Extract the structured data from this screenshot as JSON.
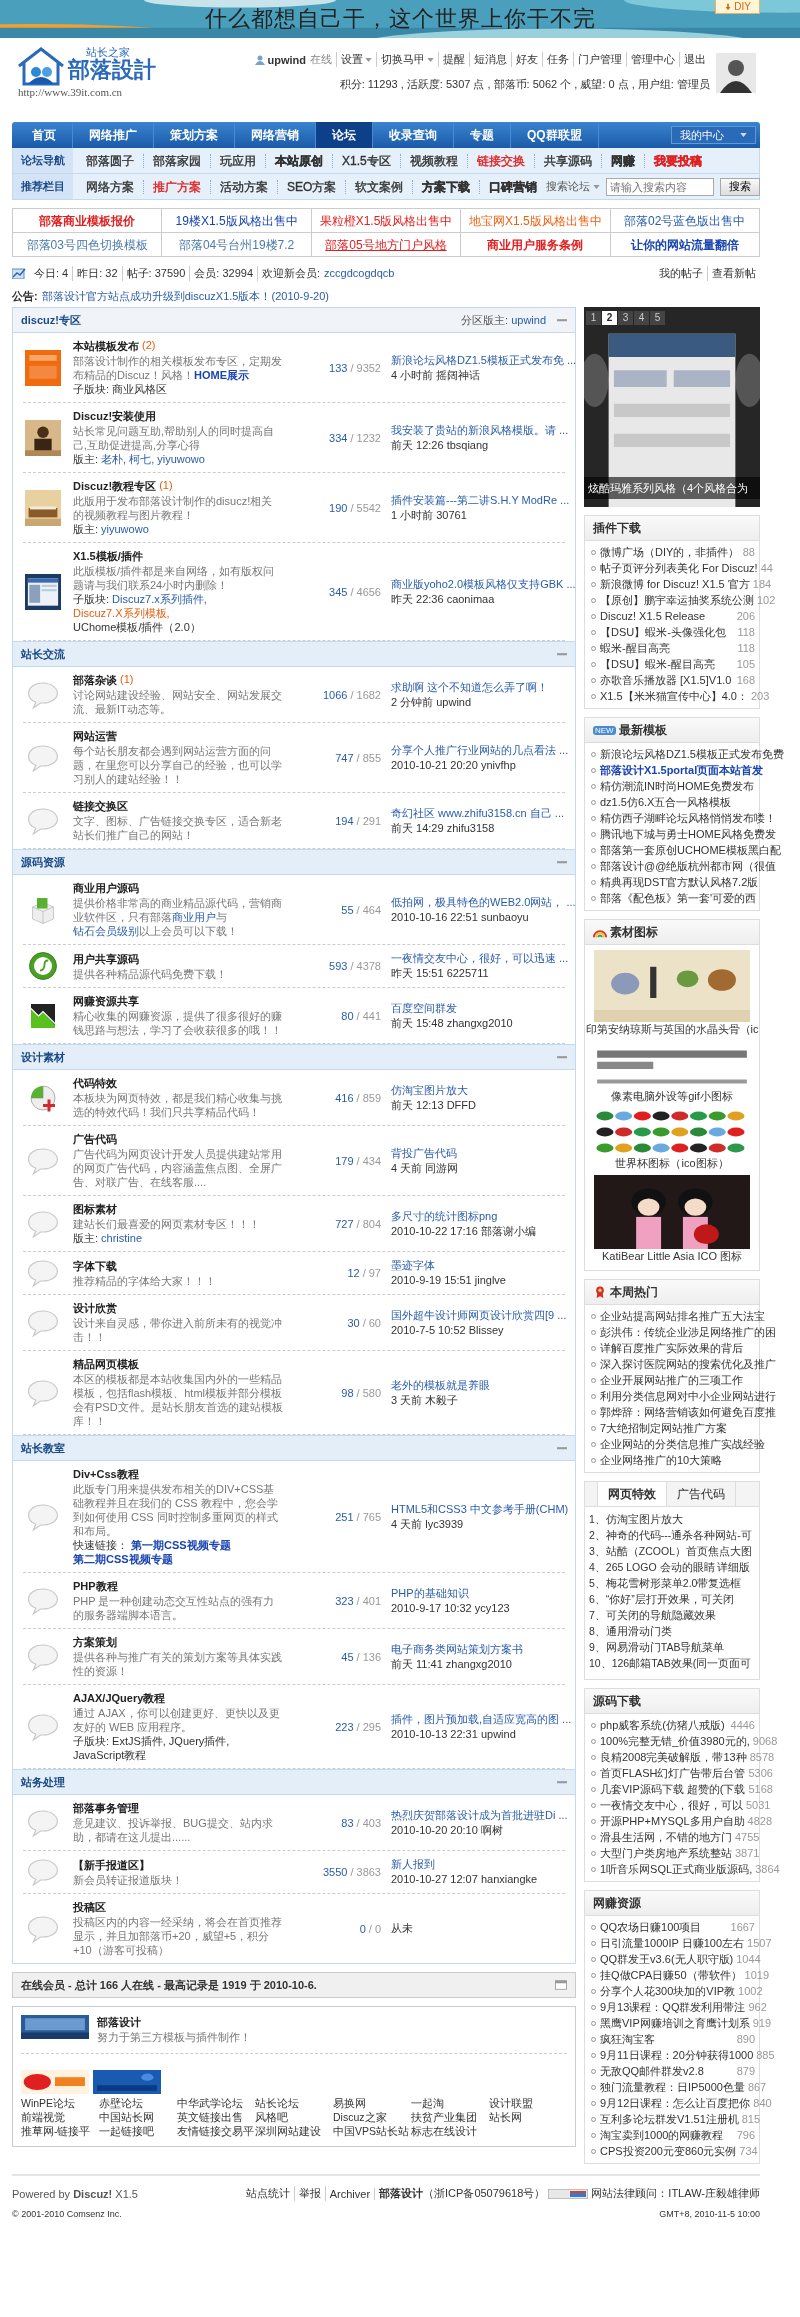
{
  "header": {
    "slogan": "什么都想自己干，这个世界上你干不完",
    "diy": "DIY",
    "logo": {
      "top": "站长之家",
      "main": "部落設計",
      "url": "http://www.39it.com.cn"
    },
    "user": {
      "name": "upwind",
      "status": "在线",
      "menu": [
        {
          "text": "设置",
          "dropdown": true
        },
        {
          "text": "切换马甲",
          "dropdown": true
        },
        {
          "text": "提醒",
          "dropdown": false
        },
        {
          "text": "短消息",
          "dropdown": false
        },
        {
          "text": "好友",
          "dropdown": false
        },
        {
          "text": "任务",
          "dropdown": false
        },
        {
          "text": "门户管理",
          "dropdown": false
        },
        {
          "text": "管理中心",
          "dropdown": false
        },
        {
          "text": "退出",
          "dropdown": false
        }
      ],
      "stats": "积分: 11293 , 活跃度: 5307 点 , 部落币: 5062 个 , 威望: 0 点 , 用户组: 管理员"
    }
  },
  "nav": {
    "items": [
      {
        "label": "首页",
        "selected": false
      },
      {
        "label": "网络推广",
        "selected": false
      },
      {
        "label": "策划方案",
        "selected": false
      },
      {
        "label": "网络营销",
        "selected": false
      },
      {
        "label": "论坛",
        "selected": true
      },
      {
        "label": "收录查询",
        "selected": false
      },
      {
        "label": "专题",
        "selected": false
      },
      {
        "label": "QQ群联盟",
        "selected": false
      }
    ],
    "my_center": "我的中心"
  },
  "subnav": [
    {
      "label": "论坛导航",
      "items": [
        {
          "text": "部落圆子",
          "color": "#333333",
          "bold": false
        },
        {
          "text": "部落家园",
          "color": "#333333",
          "bold": false
        },
        {
          "text": "玩应用",
          "color": "#333333",
          "bold": false
        },
        {
          "text": "本站原创",
          "color": "#333333",
          "bold": true
        },
        {
          "text": "X1.5专区",
          "color": "#333333",
          "bold": false
        },
        {
          "text": "视频教程",
          "color": "#333333",
          "bold": false
        },
        {
          "text": "链接交换",
          "color": "#e02020",
          "bold": false
        },
        {
          "text": "共享源码",
          "color": "#333333",
          "bold": false
        },
        {
          "text": "网赚",
          "color": "#333333",
          "bold": true
        },
        {
          "text": "我要投稿",
          "color": "#e02020",
          "bold": true
        }
      ]
    },
    {
      "label": "推荐栏目",
      "items": [
        {
          "text": "网络方案",
          "color": "#333333",
          "bold": false
        },
        {
          "text": "推广方案",
          "color": "#e02020",
          "bold": false
        },
        {
          "text": "活动方案",
          "color": "#333333",
          "bold": false
        },
        {
          "text": "SEO方案",
          "color": "#333333",
          "bold": false
        },
        {
          "text": "软文案例",
          "color": "#333333",
          "bold": false
        },
        {
          "text": "方案下载",
          "color": "#333333",
          "bold": true
        },
        {
          "text": "口碑营销",
          "color": "#333333",
          "bold": true
        }
      ]
    }
  ],
  "search": {
    "scope": "搜索论坛",
    "placeholder": "请输入搜索内容",
    "button": "搜索"
  },
  "promos": [
    {
      "text": "部落商业模板报价",
      "color": "#e02020",
      "bold": true,
      "underline": false
    },
    {
      "text": "19楼X1.5版风格出售中",
      "color": "#1a44b0",
      "bold": false,
      "underline": false
    },
    {
      "text": "果粒橙X1.5版风格出售中",
      "color": "#e02020",
      "bold": false,
      "underline": false
    },
    {
      "text": "地宝网X1.5版风格出售中",
      "color": "#f06010",
      "bold": false,
      "underline": false
    },
    {
      "text": "部落02号蓝色版出售中",
      "color": "#2a5ca8",
      "bold": false,
      "underline": false
    },
    {
      "text": "部落03号四色切换模板",
      "color": "#4a7aa8",
      "bold": false,
      "underline": false
    },
    {
      "text": "部落04号台州19楼7.2",
      "color": "#4a7aa8",
      "bold": false,
      "underline": false
    },
    {
      "text": "部落05号地方门户风格",
      "color": "#e02020",
      "bold": false,
      "underline": true
    },
    {
      "text": "商业用户服务条例",
      "color": "#e02020",
      "bold": true,
      "underline": false
    },
    {
      "text": "让你的网站流量翻倍",
      "color": "#1a44b0",
      "bold": true,
      "underline": false
    }
  ],
  "stats": {
    "items": [
      "今日: 4",
      "昨日: 32",
      "帖子: 37590",
      "会员: 32994"
    ],
    "newest_label": "欢迎新会员:",
    "newest": "zccgdcogdqcb",
    "links": [
      "我的帖子",
      "查看新帖"
    ]
  },
  "notice": {
    "label": "公告:",
    "text": "部落设计官方站点成功升级到discuzX1.5版本！(2010-9-20)"
  },
  "forum": [
    {
      "title": "discuz!专区",
      "moderator_label": "分区版主:",
      "moderator": "upwind",
      "rows": [
        {
          "kind": "picture",
          "name": "本站模板发布",
          "count": "(2)",
          "desc": [
            {
              "text": "部落设计制作的相关模板发布专区，定期发布精品的Discuz！风格！",
              "kind": "text"
            },
            {
              "text": "HOME展示",
              "kind": "strong"
            }
          ],
          "extra": {
            "label": "子版块:",
            "items": [
              {
                "text": "商业风格区",
                "kind": "text"
              }
            ]
          },
          "threads": "133",
          "posts": "/ 9352",
          "last_title": "新浪论坛风格DZ1.5模板正式发布免 ...",
          "last_meta": "4 小时前 摇阔神话"
        },
        {
          "kind": "picture",
          "name": "Discuz!安装使用",
          "desc": "站长常见问题互助,帮助别人的同时提高自己,互助促进提高,分享心得",
          "extra": {
            "label": "版主:",
            "items": [
              {
                "text": "老朴,",
                "kind": "link"
              },
              {
                "text": "柯七,",
                "kind": "link"
              },
              {
                "text": "yiyuwowo",
                "kind": "link"
              }
            ]
          },
          "threads": "334",
          "posts": "/ 1232",
          "last_title": "我安装了贵站的新浪风格模版。请 ...",
          "last_meta": "前天 12:26 tbsqiang"
        },
        {
          "kind": "picture",
          "name": "Discuz!教程专区",
          "count": "(1)",
          "desc": "此版用于发布部落设计制作的disucz!相关的视频教程与图片教程！",
          "extra": {
            "label": "版主:",
            "items": [
              {
                "text": "yiyuwowo",
                "kind": "link"
              }
            ]
          },
          "threads": "190",
          "posts": "/ 5542",
          "last_title": "插件安装篇---第二讲S.H.Y ModRe ...",
          "last_meta": "1 小时前 30761"
        },
        {
          "kind": "picture",
          "name": "X1.5模板/插件",
          "desc": "此版模板/插件都是来自网络，如有版权问题请与我们联系24小时内删除！",
          "extra": {
            "label": "子版块:",
            "items": [
              {
                "text": "Discuz7.x系列插件,",
                "kind": "link"
              },
              {
                "text": "Discuz7.X系列模板,",
                "kind": "hot"
              },
              {
                "text": "UChome模板/插件（2.0）",
                "kind": "text"
              }
            ]
          },
          "threads": "345",
          "posts": "/ 4656",
          "last_title": "商业版yoho2.0模板风格仅支持GBK ...",
          "last_meta": "昨天 22:36 caonimaa"
        }
      ]
    },
    {
      "title": "站长交流",
      "rows": [
        {
          "kind": "bubble",
          "name": "部落杂谈",
          "count": "(1)",
          "desc": "讨论网站建设经验、网站安全、网站发展交流、最新IT动态等。",
          "threads": "1066",
          "posts": "/ 1682",
          "last_title": "求助啊 这个不知道怎么弄了啊！",
          "last_meta": "2 分钟前 upwind"
        },
        {
          "kind": "bubble",
          "name": "网站运营",
          "desc": "每个站长朋友都会遇到网站运营方面的问题，在里您可以分享自己的经验，也可以学习别人的建站经验！！",
          "threads": "747",
          "posts": "/ 855",
          "last_title": "分享个人推广行业网站的几点看法 ...",
          "last_meta": "2010-10-21 20:20 ynivfhp"
        },
        {
          "kind": "bubble",
          "name": "链接交换区",
          "desc": "文字、图标、广告链接交换专区，适合新老站长们推广自己的网站！",
          "threads": "194",
          "posts": "/ 291",
          "last_title": "奇幻社区 www.zhifu3158.cn 自己 ...",
          "last_meta": "前天 14:29 zhifu3158"
        }
      ]
    },
    {
      "title": "源码资源",
      "rows": [
        {
          "kind": "box",
          "name": "商业用户源码",
          "desc": [
            {
              "text": "提供价格非常高的商业精品源代码，营销商业软件区，只有部落",
              "kind": "text"
            },
            {
              "text": "商业用户",
              "kind": "link"
            },
            {
              "text": "与",
              "kind": "text"
            },
            {
              "text": "钻石会员级别",
              "kind": "link"
            },
            {
              "text": "以上会员可以下载！",
              "kind": "text"
            }
          ],
          "threads": "55",
          "posts": "/ 464",
          "last_title": "低拍网，极具特色的WEB2.0网站， ...",
          "last_meta": "2010-10-16 22:51 sunbaoyu"
        },
        {
          "kind": "disc",
          "name": "用户共享源码",
          "desc": "提供各种精品源代码免费下载！",
          "threads": "593",
          "posts": "/ 4378",
          "last_title": "一夜情交友中心，很好，可以迅速 ...",
          "last_meta": "昨天 15:51 6225711"
        },
        {
          "kind": "chart",
          "name": "网赚资源共享",
          "desc": "精心收集的网赚资源，提供了很多很好的赚钱思路与想法，学习了会收获很多的哦！！",
          "threads": "80",
          "posts": "/ 441",
          "last_title": "百度空间群发",
          "last_meta": "前天 15:48 zhangxg2010"
        }
      ]
    },
    {
      "title": "设计素材",
      "rows": [
        {
          "kind": "pie",
          "name": "代码特效",
          "desc": "本板块为网页特效，都是我们精心收集与挑选的特效代码！我们只共享精品代码！",
          "threads": "416",
          "posts": "/ 859",
          "last_title": "仿淘宝图片放大",
          "last_meta": "前天 12:13 DFFD"
        },
        {
          "kind": "bubble",
          "name": "广告代码",
          "desc": "广告代码为网页设计开发人员提供建站常用的网页广告代码，内容涵盖焦点图、全屏广告、对联广告、在线客服....",
          "threads": "179",
          "posts": "/ 434",
          "last_title": "背投广告代码",
          "last_meta": "4 天前 同游网"
        },
        {
          "kind": "bubble",
          "name": "图标素材",
          "desc": "建站长们最喜爱的网页素材专区！！！",
          "extra": {
            "label": "版主:",
            "items": [
              {
                "text": "christine",
                "kind": "link"
              }
            ]
          },
          "threads": "727",
          "posts": "/ 804",
          "last_title": "多尺寸的统计图标png",
          "last_meta": "2010-10-22 17:16 部落谢小编"
        },
        {
          "kind": "bubble",
          "name": "字体下载",
          "desc": "推荐精品的字体给大家！！！",
          "threads": "12",
          "posts": "/ 97",
          "last_title": "墨迹字体",
          "last_meta": "2010-9-19 15:51 jinglve"
        },
        {
          "kind": "bubble",
          "name": "设计欣赏",
          "desc": "设计来自灵感，带你进入前所未有的视觉冲击！！",
          "threads": "30",
          "posts": "/ 60",
          "last_title": "国外超牛设计师网页设计欣赏四[9 ...",
          "last_meta": "2010-7-5 10:52 Blissey"
        },
        {
          "kind": "bubble",
          "name": "精品网页模板",
          "desc": "本区的模板都是本站收集国内外的一些精品模板，包括flash模板、html模板并部分模板会有PSD文件。是站长朋友首选的建站模板库！！",
          "threads": "98",
          "posts": "/ 580",
          "last_title": "老外的模板就是养眼",
          "last_meta": "3 天前 木毅子"
        }
      ]
    },
    {
      "title": "站长教室",
      "rows": [
        {
          "kind": "bubble",
          "name": "Div+Css教程",
          "desc": "此版专门用来提供发布相关的DIV+CSS基础教程并且在我们的 CSS 教程中，您会学到如何使用 CSS 同时控制多重网页的样式和布局。",
          "extra": {
            "label": "快速链接：",
            "items": [
              {
                "text": "第一期CSS视频专题",
                "kind": "strong"
              },
              {
                "text": "第二期CSS视频专题",
                "kind": "strong"
              }
            ]
          },
          "threads": "251",
          "posts": "/ 765",
          "last_title": "HTML5和CSS3 中文参考手册(CHM)",
          "last_meta": "4 天前 lyc3939"
        },
        {
          "kind": "bubble",
          "name": "PHP教程",
          "desc": "PHP 是一种创建动态交互性站点的强有力的服务器端脚本语言。",
          "threads": "323",
          "posts": "/ 401",
          "last_title": "PHP的基础知识",
          "last_meta": "2010-9-17 10:32 ycy123"
        },
        {
          "kind": "bubble",
          "name": "方案策划",
          "desc": "提供各种与推广有关的策划方案等具体实践性的资源！",
          "threads": "45",
          "posts": "/ 136",
          "last_title": "电子商务类网站策划方案书",
          "last_meta": "前天 11:41 zhangxg2010"
        },
        {
          "kind": "bubble",
          "name": "AJAX/JQuery教程",
          "desc": "通过 AJAX，你可以创建更好、更快以及更友好的 WEB 应用程序。",
          "extra": {
            "label": "子版块:",
            "items": [
              {
                "text": "ExtJS插件,",
                "kind": "text"
              },
              {
                "text": "JQuery插件,",
                "kind": "text"
              },
              {
                "text": "JavaScript教程",
                "kind": "text"
              }
            ]
          },
          "threads": "223",
          "posts": "/ 295",
          "last_title": "插件，图片预加载,自适应宽高的图 ...",
          "last_meta": "2010-10-13 22:31 upwind"
        }
      ]
    },
    {
      "title": "站务处理",
      "rows": [
        {
          "kind": "bubble",
          "name": "部落事务管理",
          "desc": "意见建议、投诉举报、BUG提交、站内求助，都请在这儿提出......",
          "threads": "83",
          "posts": "/ 403",
          "last_title": "热烈庆贺部落设计成为首批进驻Di ...",
          "last_meta": "2010-10-20 20:10 啊树"
        },
        {
          "kind": "bubble",
          "name": "【新手报道区】",
          "desc": "新会员转证报道版块！",
          "threads": "3550",
          "posts": "/ 3863",
          "last_title": "新人报到",
          "last_meta": "2010-10-27 12:07 hanxiangke"
        },
        {
          "kind": "bubble",
          "name": "投稿区",
          "desc": "投稿区内的内容一经采纳，将会在首页推荐显示，并且加部落币+20，威望+5，积分+10（游客可投稿）",
          "threads": "0",
          "posts": "/ 0",
          "last_never": "从未"
        }
      ]
    }
  ],
  "online": "在线会员 - 总计 166 人在线 - 最高记录是 1919 于 2010-10-6.",
  "links_box": {
    "site_name": "部落设计",
    "site_desc": "努力于第三方模板与插件制作！",
    "links": [
      "WinPE论坛",
      "赤壁论坛",
      "中华武学论坛",
      "站长论坛",
      "易换网",
      "一起淘",
      "设计联盟",
      "前端视觉",
      "中国站长网",
      "英文链接出售",
      "风格吧",
      "Discuz之家",
      "扶贫产业集团",
      "站长网",
      "推草网-链接平",
      "一起链接吧",
      "友情链接交易平",
      "深圳网站建设",
      "中国VPS站长站",
      "标志在线设计"
    ]
  },
  "sidebar": {
    "slides": {
      "tabs": [
        {
          "label": "1",
          "selected": false
        },
        {
          "label": "2",
          "selected": true
        },
        {
          "label": "3",
          "selected": false
        },
        {
          "label": "4",
          "selected": false
        },
        {
          "label": "5",
          "selected": false
        }
      ],
      "caption": "炫酷玛雅系列风格（4个风格合为"
    },
    "plugins": {
      "title": "插件下载",
      "items": [
        {
          "text": "微博广场（DIY的，非插件）",
          "count": "88"
        },
        {
          "text": "帖子页评分列表美化 For Discuz!",
          "count": "44"
        },
        {
          "text": "新浪微博 for Discuz! X1.5 官方",
          "count": "184"
        },
        {
          "text": "【原创】鹏宇幸运抽奖系统公测",
          "count": "102"
        },
        {
          "text": "Discuz! X1.5 Release",
          "count": "206"
        },
        {
          "text": "【DSU】蝦米-头像强化包",
          "count": "118"
        },
        {
          "text": "蝦米-醒目高亮",
          "count": "118"
        },
        {
          "text": "【DSU】蝦米-醒目高亮",
          "count": "105"
        },
        {
          "text": "亦歌音乐播放器 [X1.5]V1.0",
          "count": "168"
        },
        {
          "text": "X1.5【米米猫宣传中心】4.0：",
          "count": "203"
        }
      ]
    },
    "templates": {
      "title": "最新模板",
      "badge": "NEW",
      "items": [
        {
          "text": "新浪论坛风格DZ1.5模板正式发布免费",
          "hot": false
        },
        {
          "text": "部落设计X1.5portal页面本站首发",
          "hot": true
        },
        {
          "text": "精仿潮流IN时尚HOME免费发布",
          "hot": false
        },
        {
          "text": "dz1.5仿6.X五合一风格模板",
          "hot": false
        },
        {
          "text": "精仿西子湖畔论坛风格悄悄发布喽！",
          "hot": false
        },
        {
          "text": "腾讯地下城与勇士HOME风格免费发",
          "hot": false
        },
        {
          "text": "部落第一套原创UCHOME模板黑白配",
          "hot": false
        },
        {
          "text": "部落设计@@绝版杭州都市网（很值",
          "hot": false
        },
        {
          "text": "精典再现DST官方默认风格7.2版",
          "hot": false
        },
        {
          "text": "部落《配色板》第一套'可爱的西",
          "hot": false
        }
      ]
    },
    "gallery": {
      "title": "素材图标",
      "items": [
        {
          "caption": "印第安纳琼斯与英国的水晶头骨（ic"
        },
        {
          "caption": "像素电脑外设等gif小图标"
        },
        {
          "caption": "世界杯图标（ico图标）"
        },
        {
          "caption": "KatiBear Little Asia ICO 图标"
        }
      ]
    },
    "hot": {
      "title": "本周热门",
      "items": [
        "企业站提高网站排名推广五大法宝",
        "彭洪伟：传统企业涉足网络推广的困",
        "详解百度推广实际效果的背后",
        "深入探讨医院网站的搜索优化及推广",
        "企业开展网站推广的三项工作",
        "利用分类信息网对中小企业网站进行",
        "郭烨辞：网络营销该如何避免百度推",
        "7大绝招制定网站推广方案",
        "企业网站的分类信息推广实战经验",
        "企业网络推广的10大策略"
      ]
    },
    "effects": {
      "tabs": [
        {
          "label": "网页特效",
          "selected": true
        },
        {
          "label": "广告代码",
          "selected": false
        }
      ],
      "items": [
        "1、仿淘宝图片放大",
        "2、神奇的代码---通杀各种网站-可",
        "3、站酷（ZCOOL）首页焦点大图",
        "4、265 LOGO 会动的眼睛 详细版",
        "5、梅花雪树形菜单2.0带复选框",
        "6、“你好”层打开效果，可关闭",
        "7、可关闭的导航隐藏效果",
        "8、通用滑动门类",
        "9、网易滑动门TAB导航菜单",
        "10、126邮箱TAB效果(同一页面可"
      ]
    },
    "source": {
      "title": "源码下载",
      "items": [
        {
          "text": "php威客系统(仿猪八戒版)",
          "count": "4446"
        },
        {
          "text": "100%完整无错_价值3980元的,",
          "count": "9068"
        },
        {
          "text": "良精2008完美破解版，带13种",
          "count": "8578"
        },
        {
          "text": "首页FLASH幻灯广告带后台管",
          "count": "5306"
        },
        {
          "text": "几套VIP源码下载 超赞的(下载",
          "count": "5168"
        },
        {
          "text": "一夜情交友中心，很好，可以",
          "count": "5031"
        },
        {
          "text": "开源PHP+MYSQL多用户自助",
          "count": "4828"
        },
        {
          "text": "滑县生活网，不错的地方门",
          "count": "4755"
        },
        {
          "text": "大型门户类房地产系统整站",
          "count": "3871"
        },
        {
          "text": "1听音乐网SQL正式商业版源码,",
          "count": "3864"
        }
      ]
    },
    "earn": {
      "title": "网赚资源",
      "items": [
        {
          "text": "QQ农场日赚100项目",
          "count": "1667"
        },
        {
          "text": "日引流量1000IP 日赚100左右",
          "count": "1507"
        },
        {
          "text": "QQ群发王v3.6(无人职守版)",
          "count": "1044"
        },
        {
          "text": "挂Q做CPA日赚50（带软件）",
          "count": "1019"
        },
        {
          "text": "分享个人花300块加的VIP教",
          "count": "1002"
        },
        {
          "text": "9月13课程：QQ群发利用带注",
          "count": "962"
        },
        {
          "text": "黑鹰VIP网赚培训之育鹰计划系",
          "count": "919"
        },
        {
          "text": "疯狂淘宝客",
          "count": "890"
        },
        {
          "text": "9月11日课程：20分钟获得1000",
          "count": "885"
        },
        {
          "text": "无敌QQ邮件群发v2.8",
          "count": "879"
        },
        {
          "text": "独门流量教程：日IP5000色量",
          "count": "867"
        },
        {
          "text": "9月12日课程：怎么让百度把你",
          "count": "840"
        },
        {
          "text": "互利多论坛群发V1.51注册机",
          "count": "815"
        },
        {
          "text": "淘宝卖到1000的网赚教程",
          "count": "796"
        },
        {
          "text": "CPS投资200元变860元实例",
          "count": "734"
        }
      ]
    }
  },
  "footer": {
    "powered": "Powered by **Discuz!** X1.5",
    "copyright": "© 2001-2010 Comsenz Inc.",
    "links": [
      "站点统计",
      "举报",
      "Archiver"
    ],
    "owner": "部落设计",
    "icp": "（浙ICP备05079618号）",
    "legal": "网站法律顾问：ITLAW-庄毅雄律师",
    "time": "GMT+8, 2010-11-5 10:00"
  }
}
